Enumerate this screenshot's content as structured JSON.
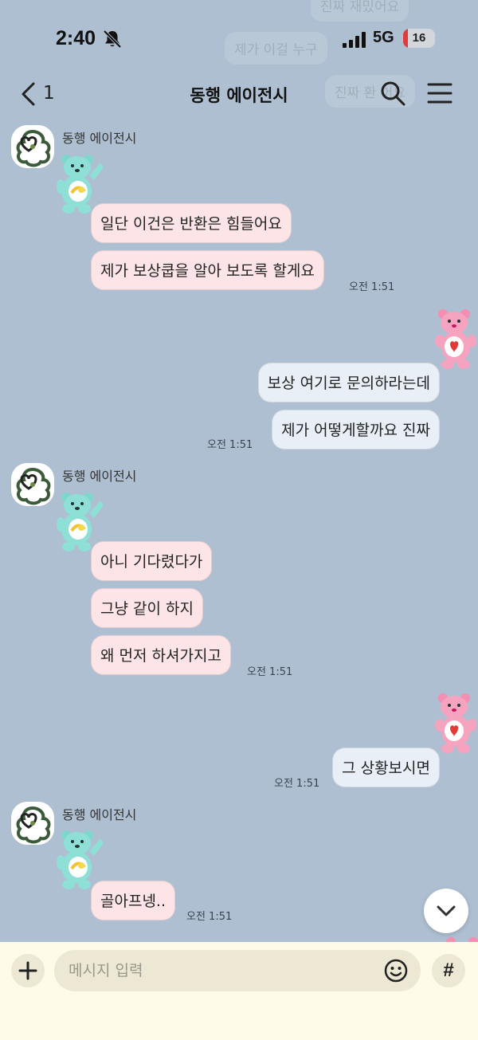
{
  "status_bar": {
    "time": "2:40",
    "network": "5G",
    "battery_percent": "16",
    "battery_level": 0.16,
    "battery_color": "#e23b3b"
  },
  "header": {
    "back_count": "1",
    "title": "동행 에이전시"
  },
  "ghost_messages": [
    "진짜 재밌어요",
    "제가 이걸 누구",
    "진짜 환 어요"
  ],
  "messages": {
    "group1": {
      "sender": "동행 에이전시",
      "bubbles": [
        "일단 이건은 반환은 힘들어요",
        "제가 보상쿱을 알아 보도록 할게요"
      ],
      "time": "오전 1:51"
    },
    "group2": {
      "bubbles": [
        "보상 여기로 문의하라는데",
        "제가 어떻게할까요 진짜"
      ],
      "time": "오전 1:51"
    },
    "group3": {
      "sender": "동행 에이전시",
      "bubbles": [
        "아니 기다렸다가",
        "그냥 같이 하지",
        "왜 먼저 하셔가지고"
      ],
      "time": "오전 1:51"
    },
    "group4": {
      "bubbles": [
        "그 상황보시면"
      ],
      "time": "오전 1:51"
    },
    "group5": {
      "sender": "동행 에이전시",
      "bubbles": [
        "골아프넹.."
      ],
      "time": "오전 1:51"
    }
  },
  "input": {
    "placeholder": "메시지 입력",
    "hash_label": "#"
  },
  "colors": {
    "background": "#adbfd1",
    "incoming_bubble": "#fde5e7",
    "outgoing_bubble": "#e8eff7",
    "input_area": "#fefbe8"
  },
  "icons": [
    "bell-off-icon",
    "signal-icon",
    "battery-icon",
    "back-chevron-icon",
    "search-icon",
    "menu-icon",
    "avatar-logo-icon",
    "teal-bear-sticker-icon",
    "pink-bear-sticker-icon",
    "chevron-down-icon",
    "plus-icon",
    "emoji-icon"
  ]
}
